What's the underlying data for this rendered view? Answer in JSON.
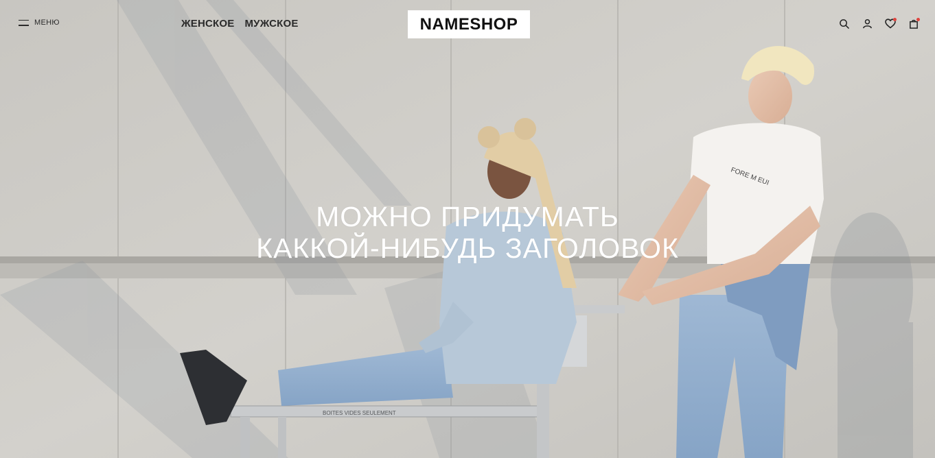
{
  "header": {
    "menu_label": "МЕНЮ",
    "nav": [
      {
        "label": "ЖЕНСКОЕ"
      },
      {
        "label": "МУЖСКОЕ"
      }
    ],
    "logo": "NAMESHOP",
    "icons": [
      "search-icon",
      "user-icon",
      "heart-icon",
      "bag-icon"
    ]
  },
  "hero": {
    "title_line1": "МОЖНО ПРИДУМАТЬ",
    "title_line2": "КАККОЙ-НИБУДЬ ЗАГОЛОВОК",
    "bench_text": "BOITES VIDES SEULEMENT",
    "tshirt_text": "FORE M EUI"
  },
  "colors": {
    "wall": "#cfcdc8",
    "accent_dot": "#e0443e",
    "text_dark": "#2a2a2a",
    "headline": "#ffffff"
  }
}
